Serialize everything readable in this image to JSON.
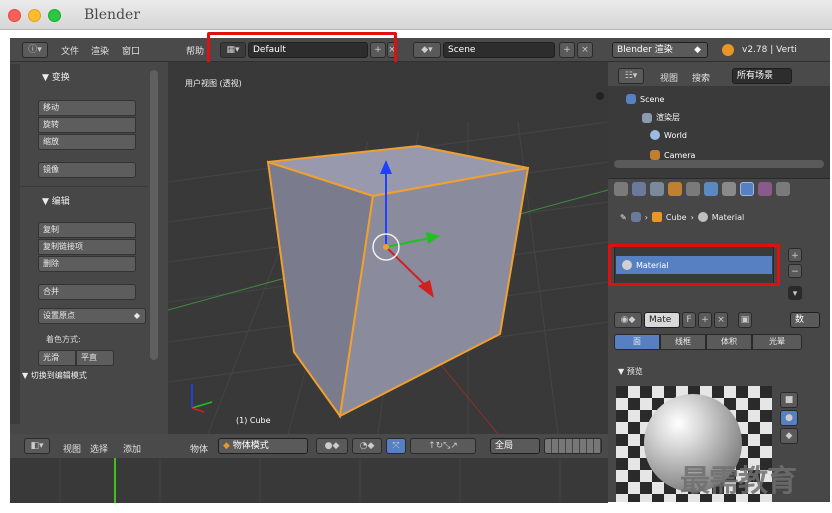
{
  "window": {
    "title": "Blender"
  },
  "topbar": {
    "menus": [
      "文件",
      "渲染",
      "窗口",
      "帮助"
    ],
    "layout": "Default",
    "scene": "Scene",
    "engine": "Blender 渲染",
    "version": "v2.78 | Verti"
  },
  "toolshelf": {
    "transform_header": "▼ 变换",
    "transform_buttons": [
      "移动",
      "旋转",
      "缩放"
    ],
    "mirror": "镜像",
    "edit_header": "▼ 编辑",
    "edit_buttons": [
      "复制",
      "复制链接项",
      "删除"
    ],
    "join": "合并",
    "set_origin": "设置原点",
    "shading_label": "着色方式:",
    "shading_smooth": "光滑",
    "shading_flat": "平直",
    "toggle_editmode": "▼ 切换到编辑模式"
  },
  "viewport": {
    "label": "用户视图 (透视)",
    "object_name": "(1) Cube"
  },
  "bottombar": {
    "items": [
      "视图",
      "选择",
      "添加",
      "物体"
    ],
    "mode": "物体模式",
    "global": "全局"
  },
  "outliner": {
    "view": "视图",
    "search": "搜索",
    "filter": "所有场景",
    "tree": [
      "Scene",
      "渲染层",
      "World",
      "Camera"
    ]
  },
  "properties": {
    "breadcrumb": [
      "Cube",
      "Material"
    ],
    "material_slot": "Material",
    "mat_field": "Mate",
    "fake_user": "F",
    "data_label": "数",
    "tabs": [
      "面",
      "线框",
      "体积",
      "光晕"
    ],
    "preview_header": "▼ 预览"
  },
  "watermark": "最需教育",
  "colors": {
    "highlight_red": "#e01010",
    "selection_blue": "#5680c2",
    "cube_outline": "#f0a030"
  }
}
